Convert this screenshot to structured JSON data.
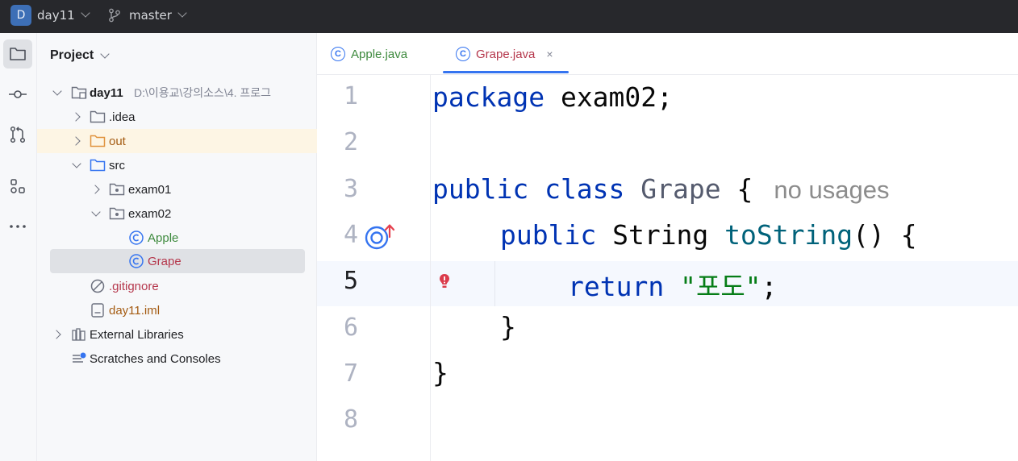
{
  "titlebar": {
    "project_badge": "D",
    "project_name": "day11",
    "branch": "master",
    "branch_icon": "git-branch-icon"
  },
  "toolstrip": {
    "items": [
      "project-folder-icon",
      "commit-icon",
      "pull-requests-icon",
      "structure-icon",
      "more-icon"
    ]
  },
  "project_panel": {
    "title": "Project",
    "tree": [
      {
        "label": "day11",
        "note": "D:\\이용교\\강의소스\\4. 프로그",
        "icon": "module-folder-icon"
      },
      {
        "label": ".idea",
        "icon": "folder-icon"
      },
      {
        "label": "out",
        "icon": "excluded-folder-icon"
      },
      {
        "label": "src",
        "icon": "source-folder-icon"
      },
      {
        "label": "exam01",
        "icon": "package-icon"
      },
      {
        "label": "exam02",
        "icon": "package-icon"
      },
      {
        "label": "Apple",
        "icon": "class-icon"
      },
      {
        "label": "Grape",
        "icon": "class-icon"
      },
      {
        "label": ".gitignore",
        "icon": "ignore-file-icon"
      },
      {
        "label": "day11.iml",
        "icon": "iml-file-icon"
      },
      {
        "label": "External Libraries",
        "icon": "libraries-icon"
      },
      {
        "label": "Scratches and Consoles",
        "icon": "scratches-icon"
      }
    ]
  },
  "editor": {
    "tabs": [
      {
        "label": "Apple.java",
        "active": false
      },
      {
        "label": "Grape.java",
        "active": true,
        "close": "×"
      }
    ],
    "line_numbers": [
      "1",
      "2",
      "3",
      "4",
      "5",
      "6",
      "7",
      "8"
    ],
    "code": {
      "l1_kw": "package",
      "l1_rest": " exam02;",
      "l3_kw": "public class",
      "l3_cls": " Grape",
      "l3_rest": " {",
      "l3_hint": "no usages",
      "l4_kw": "public",
      "l4_type": " String ",
      "l4_fn": "toString",
      "l4_rest": "() {",
      "l5_kw": "return",
      "l5_str": "\"포도\"",
      "l5_rest": ";",
      "l6": "}",
      "l7": "}"
    },
    "colors": {
      "keyword": "#0033b3",
      "function": "#00627a",
      "string": "#067d17",
      "class_unused": "#555b6e"
    }
  }
}
